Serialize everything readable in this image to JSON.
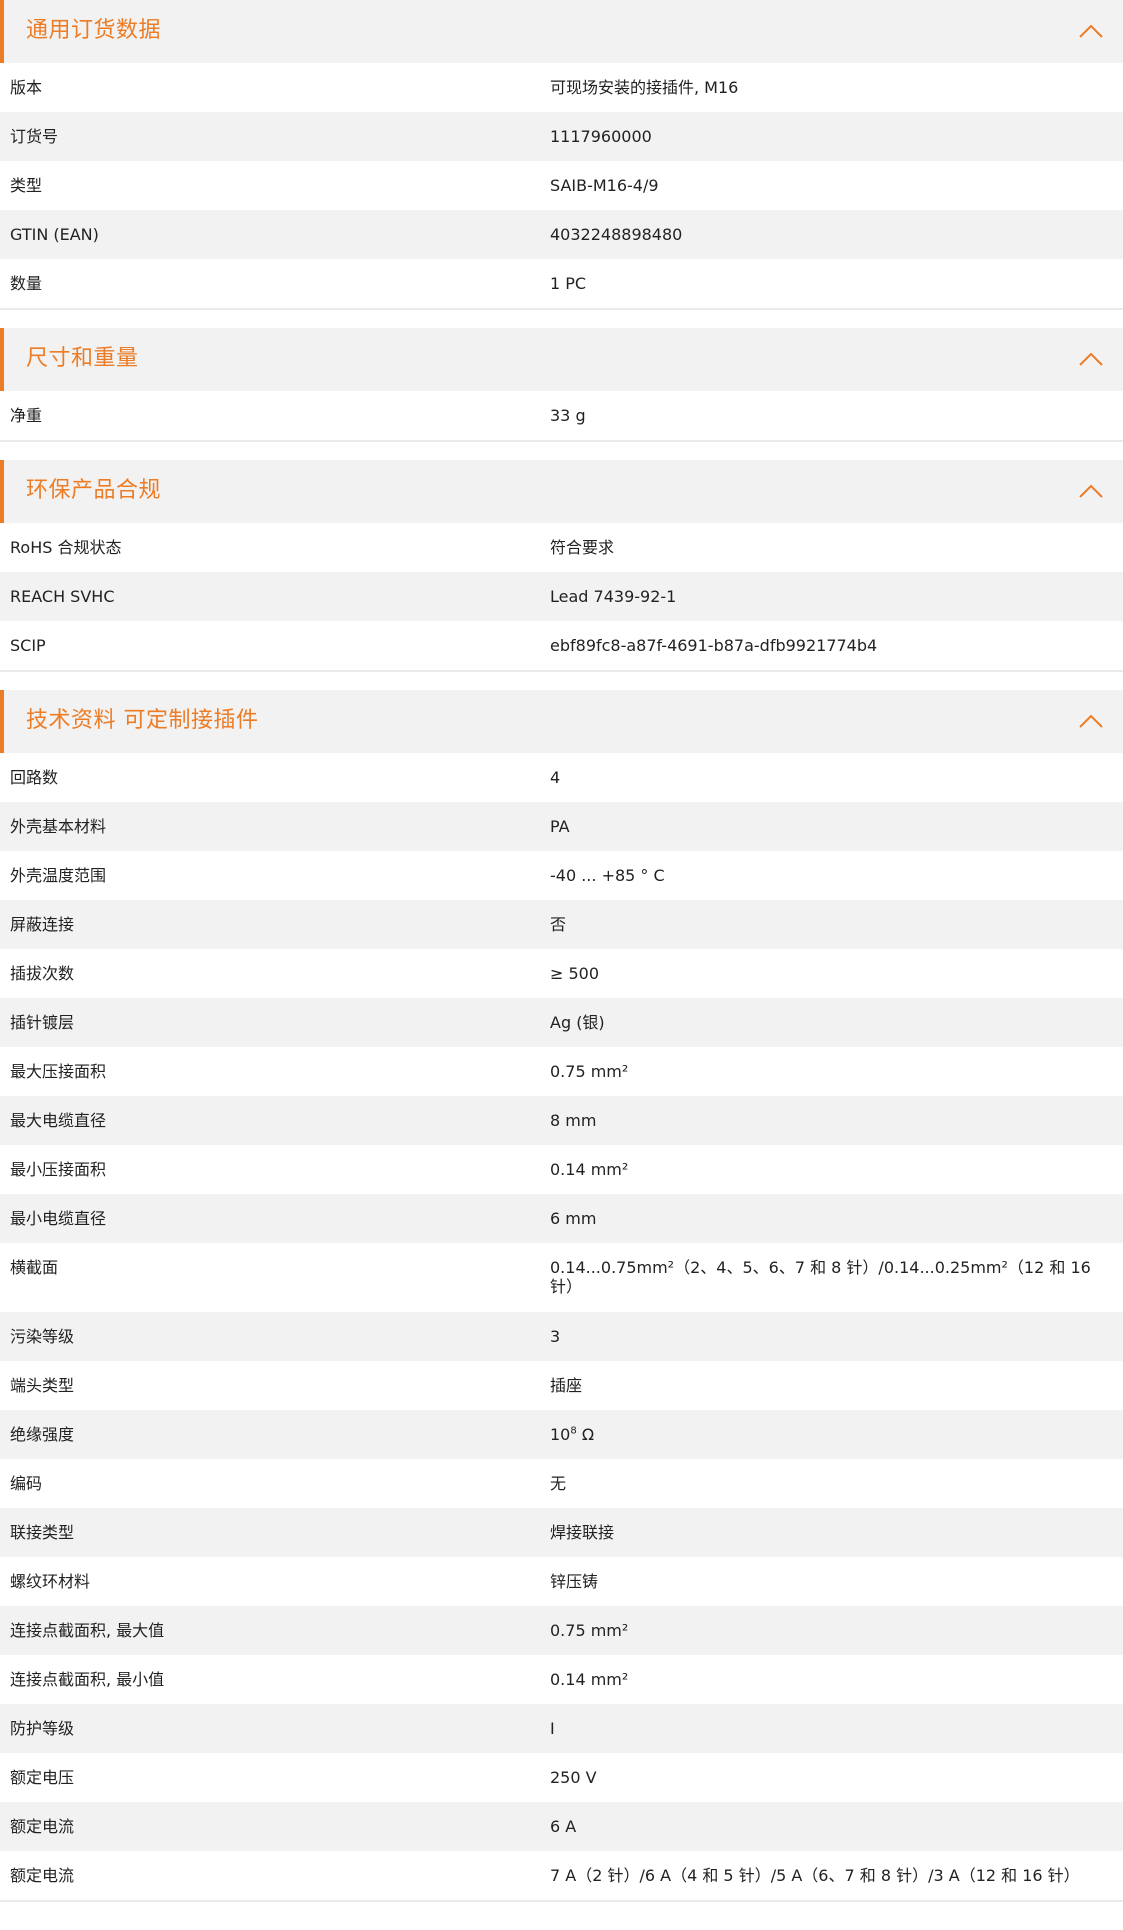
{
  "accent_color": "#ec7c26",
  "sections": [
    {
      "title": "通用订货数据",
      "rows": [
        {
          "label": "版本",
          "value": "可现场安装的接插件, M16"
        },
        {
          "label": "订货号",
          "value": "1117960000"
        },
        {
          "label": "类型",
          "value": "SAIB-M16-4/9"
        },
        {
          "label": "GTIN (EAN)",
          "value": "4032248898480"
        },
        {
          "label": "数量",
          "value": "1  PC"
        }
      ]
    },
    {
      "title": "尺寸和重量",
      "rows": [
        {
          "label": "净重",
          "value": "33  g"
        }
      ]
    },
    {
      "title": "环保产品合规",
      "rows": [
        {
          "label": "RoHS 合规状态",
          "value": "符合要求"
        },
        {
          "label": "REACH SVHC",
          "value": "Lead 7439-92-1"
        },
        {
          "label": "SCIP",
          "value": "ebf89fc8-a87f-4691-b87a-dfb9921774b4"
        }
      ]
    },
    {
      "title": "技术资料 可定制接插件",
      "rows": [
        {
          "label": "回路数",
          "value": "4"
        },
        {
          "label": "外壳基本材料",
          "value": "PA"
        },
        {
          "label": "外壳温度范围",
          "value": "-40 ... +85 ° C"
        },
        {
          "label": "屏蔽连接",
          "value": "否"
        },
        {
          "label": "插拔次数",
          "value": "≥ 500"
        },
        {
          "label": "插针镀层",
          "value": "Ag (银)"
        },
        {
          "label": "最大压接面积",
          "value": "0.75  mm²"
        },
        {
          "label": "最大电缆直径",
          "value": "8  mm"
        },
        {
          "label": "最小压接面积",
          "value": "0.14  mm²"
        },
        {
          "label": "最小电缆直径",
          "value": "6  mm"
        },
        {
          "label": "横截面",
          "value": "0.14...0.75mm²（2、4、5、6、7 和 8 针）/0.14...0.25mm²（12 和 16 针）"
        },
        {
          "label": "污染等级",
          "value": "3"
        },
        {
          "label": "端头类型",
          "value": "插座"
        },
        {
          "label": "绝缘强度",
          "value_base": "10",
          "value_exp": "8",
          "value_unit": " Ω"
        },
        {
          "label": "编码",
          "value": "无"
        },
        {
          "label": "联接类型",
          "value": "焊接联接"
        },
        {
          "label": "螺纹环材料",
          "value": "锌压铸"
        },
        {
          "label": "连接点截面积, 最大值",
          "value": "0.75  mm²"
        },
        {
          "label": "连接点截面积, 最小值",
          "value": "0.14  mm²"
        },
        {
          "label": "防护等级",
          "value": "I"
        },
        {
          "label": "额定电压",
          "value": "250  V"
        },
        {
          "label": "额定电流",
          "value": "6  A"
        },
        {
          "label": "额定电流",
          "value": "7 A（2 针）/6 A（4 和 5 针）/5 A（6、7 和 8 针）/3 A（12 和 16 针）"
        }
      ]
    }
  ]
}
